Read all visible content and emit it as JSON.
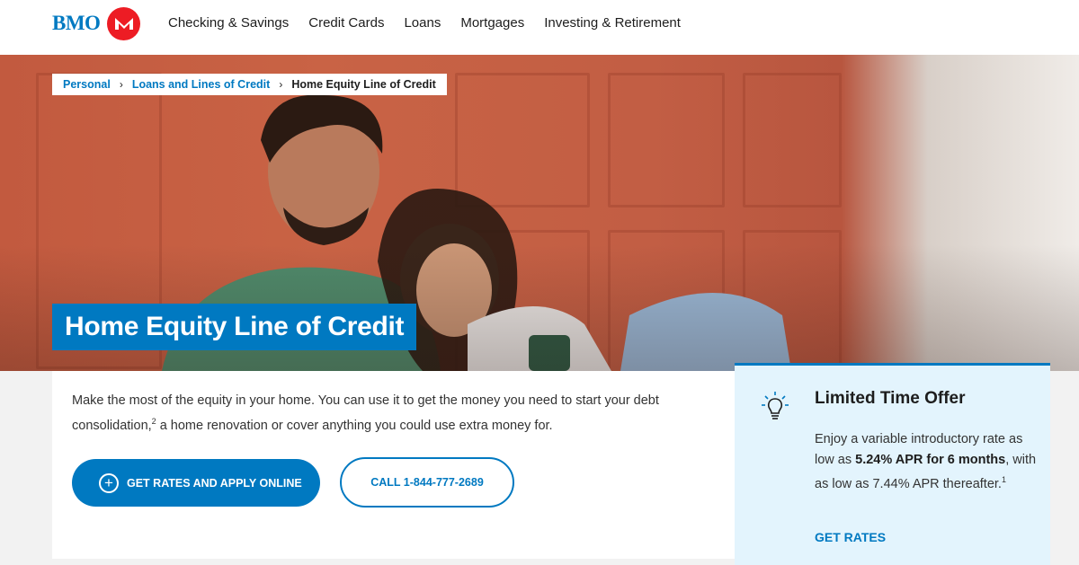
{
  "header": {
    "logo_text": "BMO",
    "nav": [
      "Checking & Savings",
      "Credit Cards",
      "Loans",
      "Mortgages",
      "Investing & Retirement"
    ]
  },
  "breadcrumb": {
    "items": [
      "Personal",
      "Loans and Lines of Credit",
      "Home Equity Line of Credit"
    ],
    "separator": "›"
  },
  "hero": {
    "title": "Home Equity Line of Credit"
  },
  "intro": {
    "text_before": "Make the most of the equity in your home. You can use it to get the money you need to start your debt consolidation,",
    "footnote": "2",
    "text_after": " a home renovation or cover anything you could use extra money for."
  },
  "buttons": {
    "primary_label": "GET RATES AND APPLY ONLINE",
    "secondary_label": "CALL 1-844-777-2689"
  },
  "offer": {
    "title": "Limited Time Offer",
    "text_before": "Enjoy a variable introductory rate as low as ",
    "highlight": "5.24% APR for 6 months",
    "text_after": ", with as low as 7.44% APR thereafter.",
    "footnote": "1",
    "link_label": "GET RATES"
  },
  "colors": {
    "brand_blue": "#0079c1",
    "brand_red": "#ed1c24",
    "offer_bg": "#e3f4fd"
  },
  "icons": [
    "bmo-roundel-icon",
    "chevron-right-icon",
    "plus-circle-icon",
    "lightbulb-icon"
  ]
}
